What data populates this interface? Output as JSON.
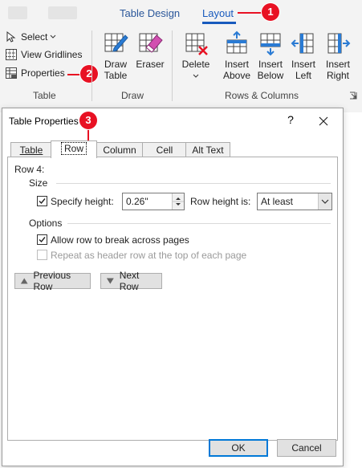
{
  "ribbon": {
    "tabs": {
      "table_design": "Table Design",
      "layout": "Layout"
    },
    "commands": {
      "select": "Select",
      "view_gridlines": "View Gridlines",
      "properties": "Properties",
      "draw_table_1": "Draw",
      "draw_table_2": "Table",
      "eraser": "Eraser",
      "delete": "Delete",
      "insert_above_1": "Insert",
      "insert_above_2": "Above",
      "insert_below_1": "Insert",
      "insert_below_2": "Below",
      "insert_left_1": "Insert",
      "insert_left_2": "Left",
      "insert_right_1": "Insert",
      "insert_right_2": "Right"
    },
    "groups": {
      "table": "Table",
      "draw": "Draw",
      "rows_columns": "Rows & Columns"
    }
  },
  "callouts": {
    "one": "1",
    "two": "2",
    "three": "3"
  },
  "colors": {
    "callout": "#e81123",
    "accent": "#185abd",
    "insert_blue": "#2a7bd4"
  },
  "dialog": {
    "title": "Table Properties",
    "help": "?",
    "tabs": {
      "table": "Table",
      "row": "Row",
      "column": "Column",
      "cell": "Cell",
      "alt_text": "Alt Text"
    },
    "row_heading": "Row 4:",
    "size_heading": "Size",
    "specify_height_label": "Specify height:",
    "specify_height_checked": true,
    "height_value": "0.26\"",
    "row_height_is_label": "Row height is:",
    "row_height_is_value": "At least",
    "options_heading": "Options",
    "allow_break_label": "Allow row to break across pages",
    "allow_break_checked": true,
    "repeat_header_label": "Repeat as header row at the top of each page",
    "repeat_header_checked": false,
    "previous_row": "Previous Row",
    "next_row": "Next Row",
    "ok": "OK",
    "cancel": "Cancel"
  }
}
